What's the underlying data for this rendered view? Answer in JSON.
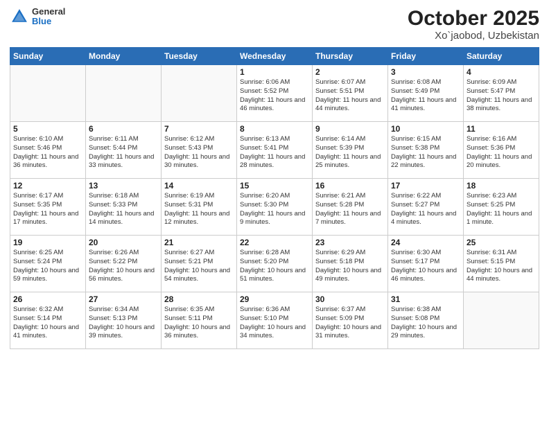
{
  "logo": {
    "general": "General",
    "blue": "Blue"
  },
  "title": "October 2025",
  "subtitle": "Xo`jaobod, Uzbekistan",
  "days_of_week": [
    "Sunday",
    "Monday",
    "Tuesday",
    "Wednesday",
    "Thursday",
    "Friday",
    "Saturday"
  ],
  "weeks": [
    [
      {
        "day": "",
        "info": ""
      },
      {
        "day": "",
        "info": ""
      },
      {
        "day": "",
        "info": ""
      },
      {
        "day": "1",
        "info": "Sunrise: 6:06 AM\nSunset: 5:52 PM\nDaylight: 11 hours and 46 minutes."
      },
      {
        "day": "2",
        "info": "Sunrise: 6:07 AM\nSunset: 5:51 PM\nDaylight: 11 hours and 44 minutes."
      },
      {
        "day": "3",
        "info": "Sunrise: 6:08 AM\nSunset: 5:49 PM\nDaylight: 11 hours and 41 minutes."
      },
      {
        "day": "4",
        "info": "Sunrise: 6:09 AM\nSunset: 5:47 PM\nDaylight: 11 hours and 38 minutes."
      }
    ],
    [
      {
        "day": "5",
        "info": "Sunrise: 6:10 AM\nSunset: 5:46 PM\nDaylight: 11 hours and 36 minutes."
      },
      {
        "day": "6",
        "info": "Sunrise: 6:11 AM\nSunset: 5:44 PM\nDaylight: 11 hours and 33 minutes."
      },
      {
        "day": "7",
        "info": "Sunrise: 6:12 AM\nSunset: 5:43 PM\nDaylight: 11 hours and 30 minutes."
      },
      {
        "day": "8",
        "info": "Sunrise: 6:13 AM\nSunset: 5:41 PM\nDaylight: 11 hours and 28 minutes."
      },
      {
        "day": "9",
        "info": "Sunrise: 6:14 AM\nSunset: 5:39 PM\nDaylight: 11 hours and 25 minutes."
      },
      {
        "day": "10",
        "info": "Sunrise: 6:15 AM\nSunset: 5:38 PM\nDaylight: 11 hours and 22 minutes."
      },
      {
        "day": "11",
        "info": "Sunrise: 6:16 AM\nSunset: 5:36 PM\nDaylight: 11 hours and 20 minutes."
      }
    ],
    [
      {
        "day": "12",
        "info": "Sunrise: 6:17 AM\nSunset: 5:35 PM\nDaylight: 11 hours and 17 minutes."
      },
      {
        "day": "13",
        "info": "Sunrise: 6:18 AM\nSunset: 5:33 PM\nDaylight: 11 hours and 14 minutes."
      },
      {
        "day": "14",
        "info": "Sunrise: 6:19 AM\nSunset: 5:31 PM\nDaylight: 11 hours and 12 minutes."
      },
      {
        "day": "15",
        "info": "Sunrise: 6:20 AM\nSunset: 5:30 PM\nDaylight: 11 hours and 9 minutes."
      },
      {
        "day": "16",
        "info": "Sunrise: 6:21 AM\nSunset: 5:28 PM\nDaylight: 11 hours and 7 minutes."
      },
      {
        "day": "17",
        "info": "Sunrise: 6:22 AM\nSunset: 5:27 PM\nDaylight: 11 hours and 4 minutes."
      },
      {
        "day": "18",
        "info": "Sunrise: 6:23 AM\nSunset: 5:25 PM\nDaylight: 11 hours and 1 minute."
      }
    ],
    [
      {
        "day": "19",
        "info": "Sunrise: 6:25 AM\nSunset: 5:24 PM\nDaylight: 10 hours and 59 minutes."
      },
      {
        "day": "20",
        "info": "Sunrise: 6:26 AM\nSunset: 5:22 PM\nDaylight: 10 hours and 56 minutes."
      },
      {
        "day": "21",
        "info": "Sunrise: 6:27 AM\nSunset: 5:21 PM\nDaylight: 10 hours and 54 minutes."
      },
      {
        "day": "22",
        "info": "Sunrise: 6:28 AM\nSunset: 5:20 PM\nDaylight: 10 hours and 51 minutes."
      },
      {
        "day": "23",
        "info": "Sunrise: 6:29 AM\nSunset: 5:18 PM\nDaylight: 10 hours and 49 minutes."
      },
      {
        "day": "24",
        "info": "Sunrise: 6:30 AM\nSunset: 5:17 PM\nDaylight: 10 hours and 46 minutes."
      },
      {
        "day": "25",
        "info": "Sunrise: 6:31 AM\nSunset: 5:15 PM\nDaylight: 10 hours and 44 minutes."
      }
    ],
    [
      {
        "day": "26",
        "info": "Sunrise: 6:32 AM\nSunset: 5:14 PM\nDaylight: 10 hours and 41 minutes."
      },
      {
        "day": "27",
        "info": "Sunrise: 6:34 AM\nSunset: 5:13 PM\nDaylight: 10 hours and 39 minutes."
      },
      {
        "day": "28",
        "info": "Sunrise: 6:35 AM\nSunset: 5:11 PM\nDaylight: 10 hours and 36 minutes."
      },
      {
        "day": "29",
        "info": "Sunrise: 6:36 AM\nSunset: 5:10 PM\nDaylight: 10 hours and 34 minutes."
      },
      {
        "day": "30",
        "info": "Sunrise: 6:37 AM\nSunset: 5:09 PM\nDaylight: 10 hours and 31 minutes."
      },
      {
        "day": "31",
        "info": "Sunrise: 6:38 AM\nSunset: 5:08 PM\nDaylight: 10 hours and 29 minutes."
      },
      {
        "day": "",
        "info": ""
      }
    ]
  ]
}
